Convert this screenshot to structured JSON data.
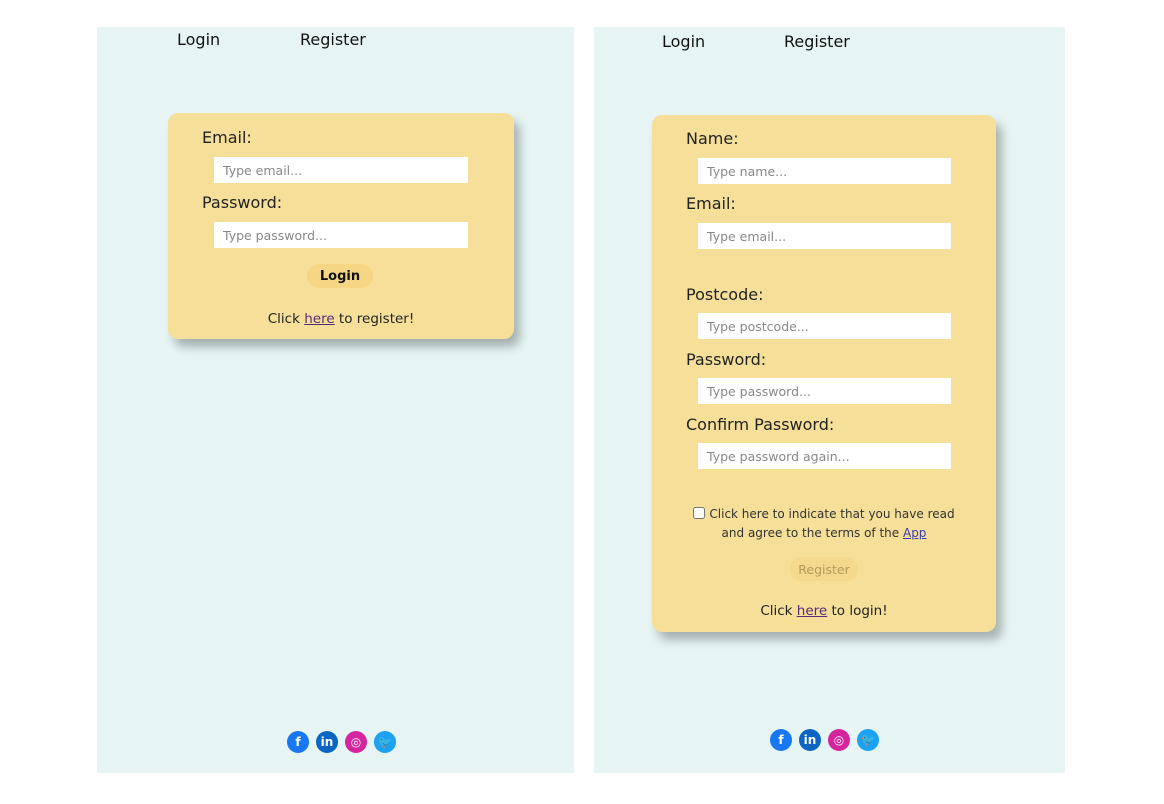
{
  "login_screen": {
    "nav": {
      "login": "Login",
      "register": "Register"
    },
    "form": {
      "email_label": "Email:",
      "email_placeholder": "Type email...",
      "password_label": "Password:",
      "password_placeholder": "Type password...",
      "submit_label": "Login",
      "footer_prefix": "Click ",
      "footer_link": "here",
      "footer_suffix": " to register!"
    }
  },
  "register_screen": {
    "nav": {
      "login": "Login",
      "register": "Register"
    },
    "form": {
      "name_label": "Name:",
      "name_placeholder": "Type name...",
      "email_label": "Email:",
      "email_placeholder": "Type email...",
      "postcode_label": "Postcode:",
      "postcode_placeholder": "Type postcode...",
      "password_label": "Password:",
      "password_placeholder": "Type password...",
      "confirm_label": "Confirm Password:",
      "confirm_placeholder": "Type password again...",
      "terms_text": "Click here to indicate that you have read and agree to the terms of the ",
      "terms_link": "App",
      "terms_checked": false,
      "submit_label": "Register",
      "footer_prefix": "Click ",
      "footer_link": "here",
      "footer_suffix": " to login!"
    }
  },
  "social_icons": [
    {
      "name": "facebook-icon",
      "glyph": "f",
      "color": "#1877f2"
    },
    {
      "name": "linkedin-icon",
      "glyph": "in",
      "color": "#0a66c2"
    },
    {
      "name": "instagram-icon",
      "glyph": "◎",
      "color": "#d6249f"
    },
    {
      "name": "twitter-icon",
      "glyph": "🐦",
      "color": "#1da1f2"
    }
  ],
  "colors": {
    "panel_bg": "#e6f5f4",
    "card_bg": "#f6df98",
    "login_button_bg": "#f4d685",
    "register_button_bg": "#f3d88e",
    "register_button_text": "#b29a5a"
  }
}
